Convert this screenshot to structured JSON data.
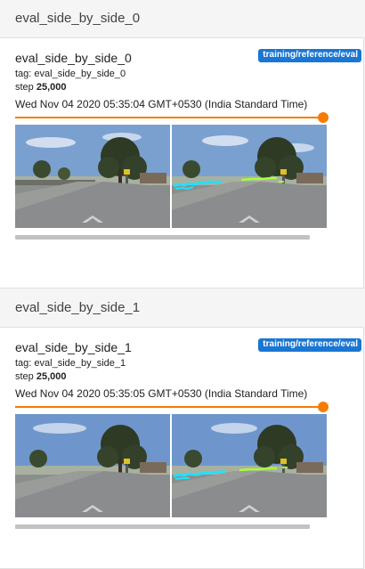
{
  "sections": [
    {
      "header": "eval_side_by_side_0",
      "card": {
        "title": "eval_side_by_side_0",
        "run_badge": "training/reference/eval",
        "tag_label": "tag: eval_side_by_side_0",
        "step_prefix": "step ",
        "step_value": "25,000",
        "timestamp": "Wed Nov 04 2020 05:35:04 GMT+0530 (India Standard Time)",
        "image_description_left": "road-scene-image",
        "image_description_right": "road-scene-image-with-lidar-overlay"
      }
    },
    {
      "header": "eval_side_by_side_1",
      "card": {
        "title": "eval_side_by_side_1",
        "run_badge": "training/reference/eval",
        "tag_label": "tag: eval_side_by_side_1",
        "step_prefix": "step ",
        "step_value": "25,000",
        "timestamp": "Wed Nov 04 2020 05:35:05 GMT+0530 (India Standard Time)",
        "image_description_left": "road-scene-image",
        "image_description_right": "road-scene-image-with-lidar-overlay"
      }
    }
  ],
  "colors": {
    "accent": "#f57c00",
    "badge": "#1976d2",
    "lidar_cyan": "#22e0ff",
    "lidar_green": "#a6ff3a"
  }
}
